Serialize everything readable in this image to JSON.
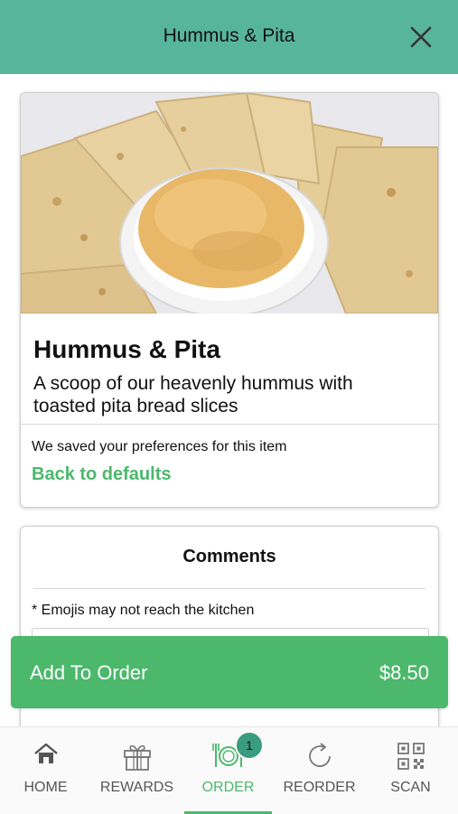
{
  "header": {
    "title": "Hummus & Pita"
  },
  "product": {
    "title": "Hummus & Pita",
    "description": "A scoop of our heavenly hummus with toasted pita bread slices",
    "preferences_note": "We saved your preferences for this item",
    "reset_label": "Back to defaults"
  },
  "comments": {
    "title": "Comments",
    "emoji_note": "* Emojis may not reach the kitchen"
  },
  "add_to_order": {
    "label": "Add To Order",
    "price": "$8.50"
  },
  "nav": {
    "items": [
      {
        "label": "HOME",
        "icon": "home-icon"
      },
      {
        "label": "REWARDS",
        "icon": "gift-icon"
      },
      {
        "label": "ORDER",
        "icon": "plate-cutlery-icon",
        "badge": "1"
      },
      {
        "label": "REORDER",
        "icon": "refresh-icon"
      },
      {
        "label": "SCAN",
        "icon": "qr-code-icon"
      }
    ],
    "active": "ORDER"
  },
  "colors": {
    "header": "#57b59b",
    "accent": "#4cb86c",
    "badge": "#3a9c7e"
  }
}
